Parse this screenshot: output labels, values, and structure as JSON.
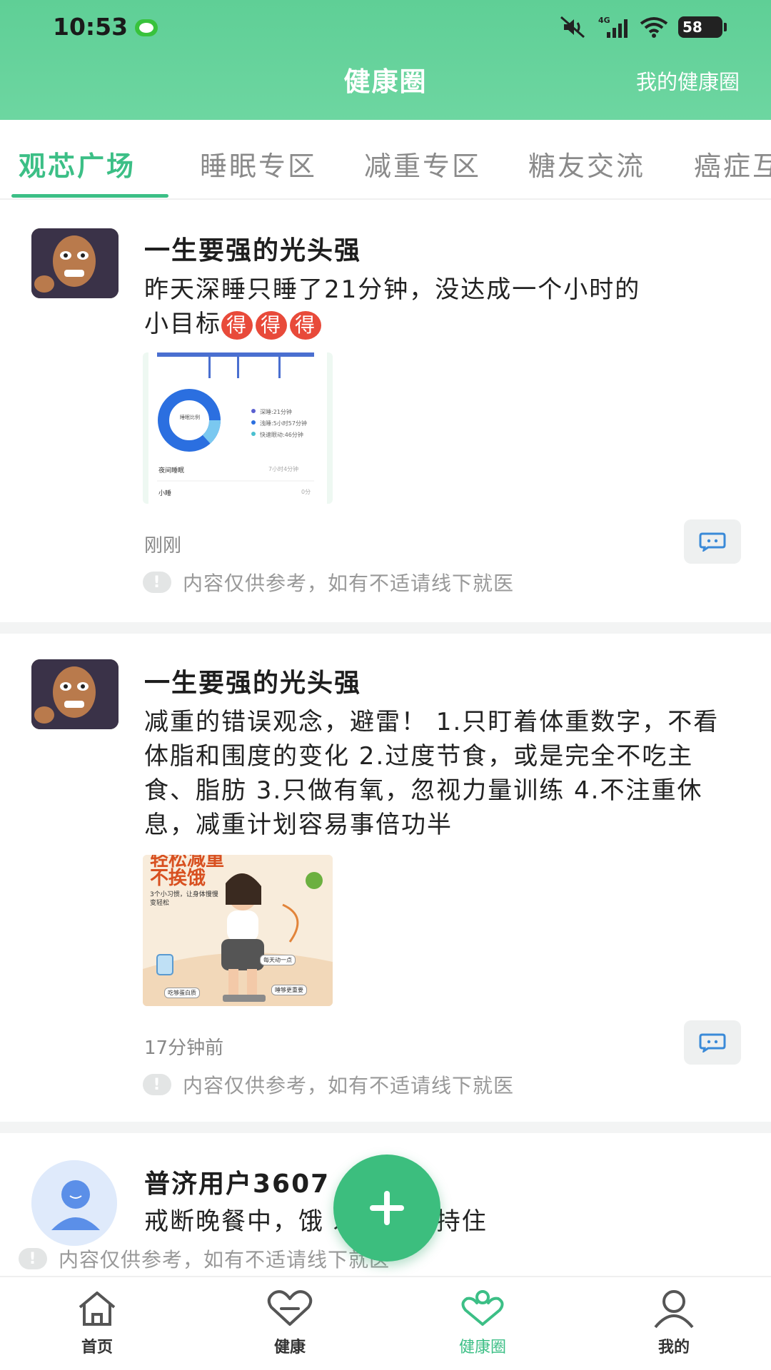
{
  "status_bar": {
    "time": "10:53",
    "network": "4G",
    "battery": "58"
  },
  "header": {
    "title": "健康圈",
    "my_circle_link": "我的健康圈"
  },
  "tabs": [
    {
      "label": "观芯广场",
      "active": true
    },
    {
      "label": "睡眠专区",
      "active": false
    },
    {
      "label": "减重专区",
      "active": false
    },
    {
      "label": "糖友交流",
      "active": false
    },
    {
      "label": "癌症互",
      "active": false
    }
  ],
  "posts": [
    {
      "username": "一生要强的光头强",
      "content_line1": "昨天深睡只睡了21分钟，没达成一个小时的",
      "content_line2": "小目标",
      "emoji": [
        "得",
        "得",
        "得"
      ],
      "image_caption": {
        "legend1": "深睡:21分钟",
        "legend2": "浅睡:5小时57分钟",
        "legend3": "快速眼动:46分钟",
        "donut_label": "睡眠比例",
        "row1": "夜间睡眠",
        "row1_value": "7小时4分钟",
        "row2": "小睡",
        "row2_value": "0分"
      },
      "time": "刚刚",
      "disclaimer": "内容仅供参考，如有不适请线下就医"
    },
    {
      "username": "一生要强的光头强",
      "content": "减重的错误观念，避雷！ 1.只盯着体重数字，不看体脂和围度的变化 2.过度节食，或是完全不吃主食、脂肪 3.只做有氧，忽视力量训练 4.不注重休息，减重计划容易事倍功半",
      "image_caption": {
        "headline1": "轻松减重",
        "headline2": "不挨饿",
        "sub": "3个小习惯，让身体慢慢变轻松",
        "tag1": "每天动一点",
        "tag2": "吃够蛋白质",
        "tag3": "睡够更重要"
      },
      "time": "17分钟前",
      "disclaimer": "内容仅供参考，如有不适请线下就医"
    },
    {
      "username": "普济用户3607",
      "content": "戒断晚餐中，饿 发软，坚持住",
      "disclaimer": "内容仅供参考，如有不适请线下就医"
    }
  ],
  "bottom_nav": [
    {
      "label": "首页",
      "icon": "home-icon",
      "active": false
    },
    {
      "label": "健康",
      "icon": "heart-icon",
      "active": false
    },
    {
      "label": "健康圈",
      "icon": "health-circle-icon",
      "active": true
    },
    {
      "label": "我的",
      "icon": "person-icon",
      "active": false
    }
  ],
  "colors": {
    "accent": "#3cbf86",
    "header": "#5fcf96",
    "fab": "#3cbe7e"
  }
}
